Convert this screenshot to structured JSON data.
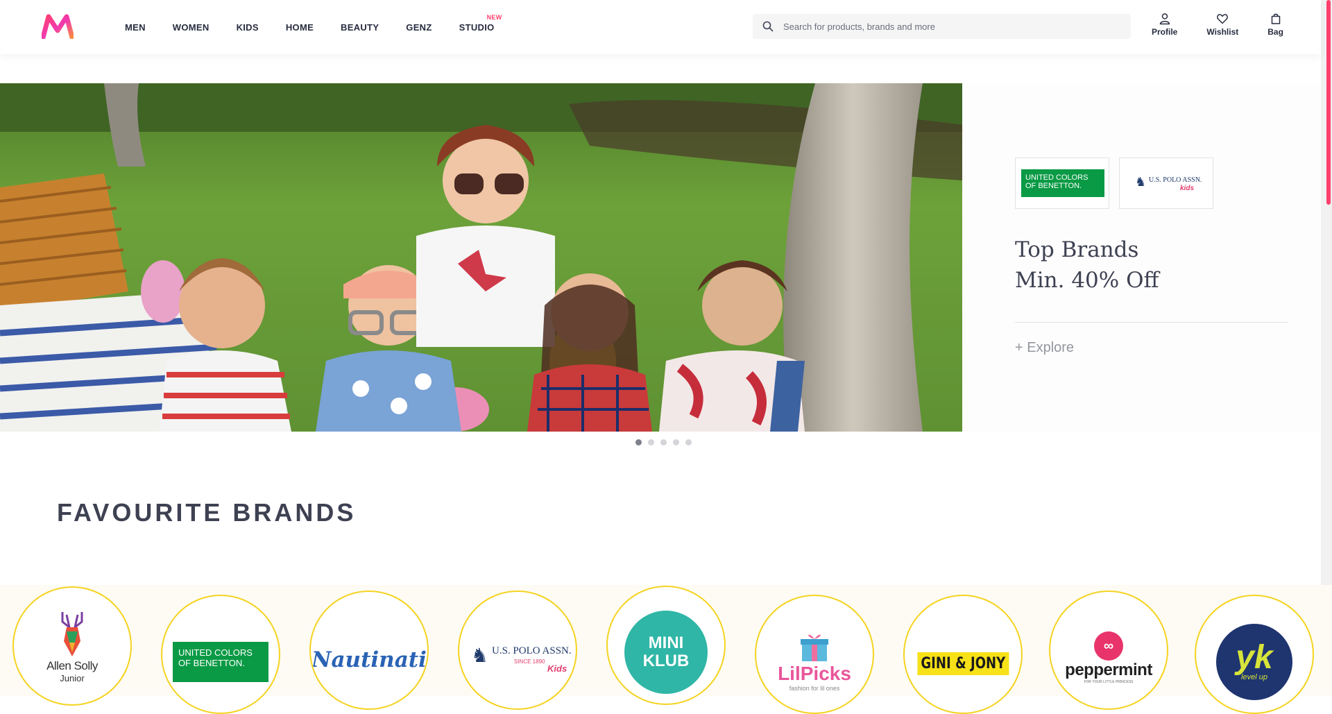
{
  "header": {
    "logo": "myntra-logo",
    "nav": [
      {
        "label": "MEN"
      },
      {
        "label": "WOMEN"
      },
      {
        "label": "KIDS"
      },
      {
        "label": "HOME"
      },
      {
        "label": "BEAUTY"
      },
      {
        "label": "GENZ"
      },
      {
        "label": "STUDIO",
        "badge": "NEW"
      }
    ],
    "search": {
      "placeholder": "Search for products, brands and more",
      "value": ""
    },
    "actions": [
      {
        "label": "Profile",
        "icon": "user-icon"
      },
      {
        "label": "Wishlist",
        "icon": "heart-icon"
      },
      {
        "label": "Bag",
        "icon": "bag-icon"
      }
    ]
  },
  "banner": {
    "brands": [
      "UNITED COLORS OF BENETTON.",
      "U.S. POLO ASSN.",
      "kids"
    ],
    "title_line1": "Top Brands",
    "title_line2": "Min. 40% Off",
    "cta": "+ Explore",
    "slides": 5,
    "active_slide": 1
  },
  "favourites": {
    "title": "FAVOURITE BRANDS",
    "brands": [
      {
        "name": "Allen Solly",
        "sub": "Junior"
      },
      {
        "name": "UNITED COLORS OF BENETTON."
      },
      {
        "name": "Nautinati"
      },
      {
        "name": "U.S. POLO ASSN.",
        "since": "SINCE 1890",
        "sub": "Kids"
      },
      {
        "name": "MINI KLUB"
      },
      {
        "name": "LilPicks",
        "sub": "fashion for lil ones"
      },
      {
        "name": "GINI & JONY"
      },
      {
        "name": "peppermint",
        "sub": "FOR YOUR LITTLE PRINCESS"
      },
      {
        "name": "yk",
        "sub": "level up"
      }
    ]
  },
  "colors": {
    "accent": "#ff3f6c",
    "brand_ring": "#f5d320"
  }
}
